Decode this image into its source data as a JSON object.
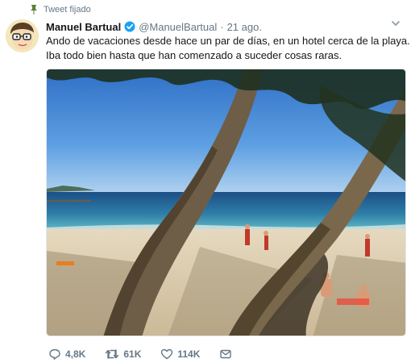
{
  "pinned": {
    "label": "Tweet fijado"
  },
  "author": {
    "name": "Manuel Bartual",
    "handle": "@ManuelBartual",
    "separator": "·",
    "time": "21 ago."
  },
  "tweet": {
    "lines": [
      "Ando de vacaciones desde hace un par de días, en un hotel cerca de la playa.",
      "Iba todo bien hasta que han comenzado a suceder cosas raras."
    ]
  },
  "actions": {
    "replies": "4,8K",
    "retweets": "61K",
    "likes": "114K"
  },
  "icons": [
    "pin-icon",
    "verified-icon",
    "chevron-down-icon",
    "reply-icon",
    "retweet-icon",
    "like-icon",
    "message-icon"
  ],
  "colors": {
    "verified": "#1da1f2",
    "secondary": "#657786",
    "pin": "#5b7e3a"
  }
}
